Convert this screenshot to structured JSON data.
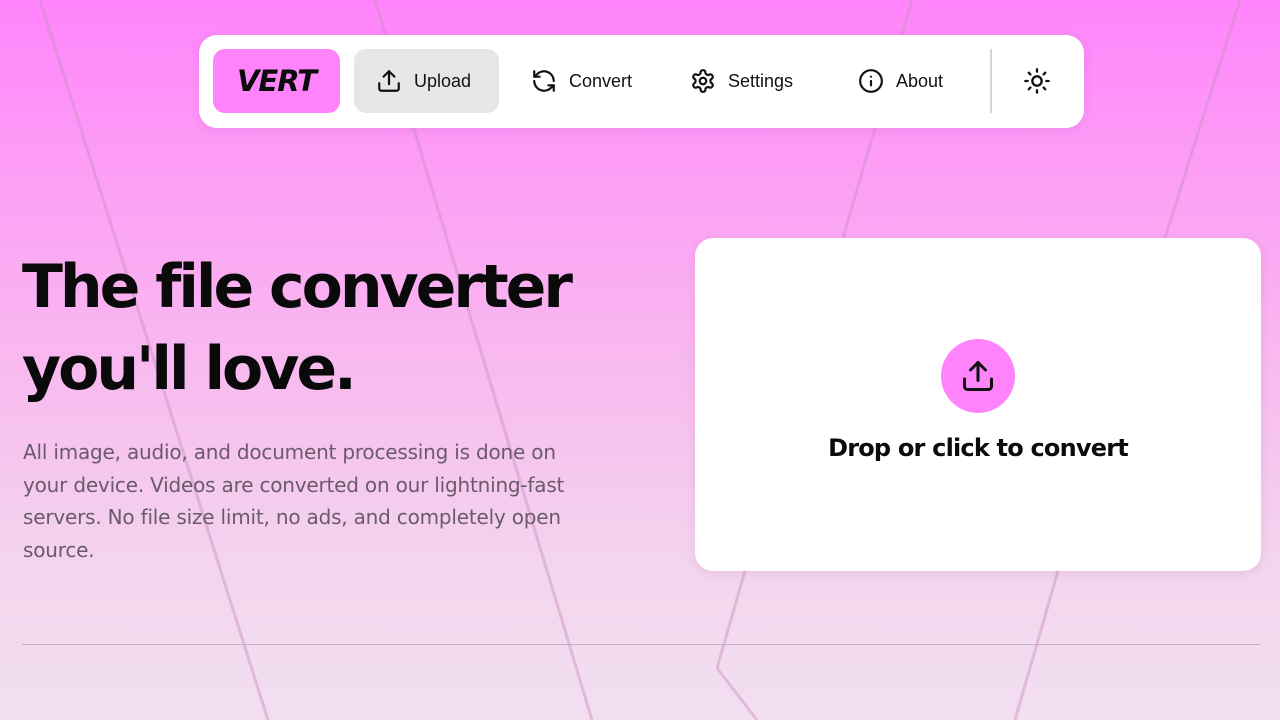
{
  "nav": {
    "logo": "VERT",
    "items": [
      {
        "label": "Upload",
        "icon": "upload-icon",
        "active": true
      },
      {
        "label": "Convert",
        "icon": "refresh-icon",
        "active": false
      },
      {
        "label": "Settings",
        "icon": "gear-icon",
        "active": false
      },
      {
        "label": "About",
        "icon": "info-icon",
        "active": false
      }
    ],
    "theme_icon": "sun-icon"
  },
  "hero": {
    "title_line1": "The file converter",
    "title_line2": "you'll love.",
    "description": "All image, audio, and document processing is done on your device. Videos are converted on our lightning-fast servers. No file size limit, no ads, and completely open source."
  },
  "dropzone": {
    "label": "Drop or click to convert",
    "icon": "upload-icon"
  },
  "colors": {
    "accent": "#ff84fb",
    "active_nav_bg": "#e6e6e6",
    "text": "#0b0b0b",
    "muted_text": "#6a5a6a"
  }
}
